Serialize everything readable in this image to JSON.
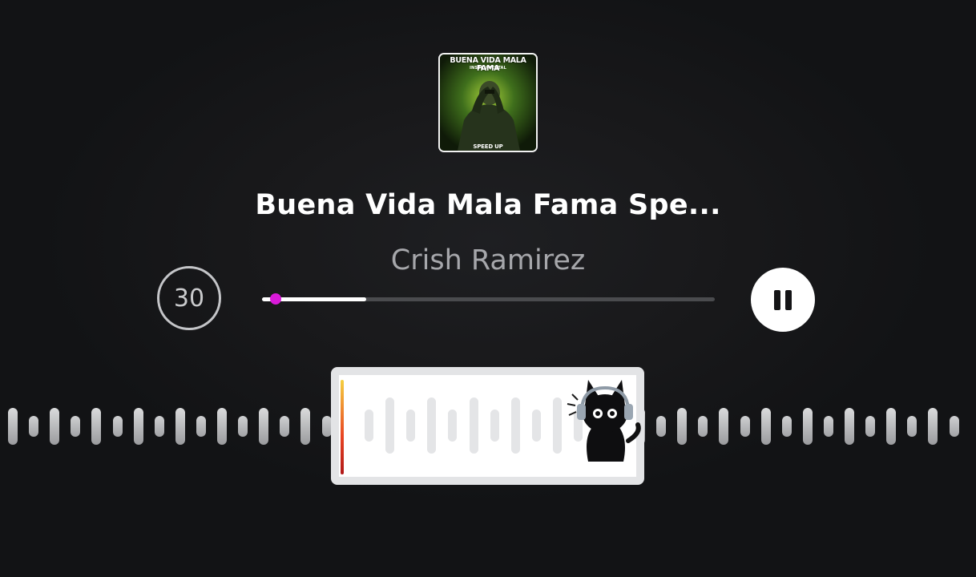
{
  "album": {
    "cover_title": "BUENA VIDA MALA FAMA",
    "cover_subtitle": "INSTRUMENTAL",
    "cover_tag": "SPEED UP"
  },
  "track": {
    "title": "Buena Vida Mala Fama Spe...",
    "artist": "Crish Ramirez"
  },
  "controls": {
    "skip_label": "30",
    "skip_icon": "skip-30-icon",
    "pause_icon": "pause-icon",
    "progress_fraction": 0.23
  },
  "waveform": {
    "selector_icon": "waveform-selector",
    "sticker": "cat-with-headphones-sticker"
  },
  "colors": {
    "background": "#121315",
    "accent": "#d91ad9",
    "text_primary": "#ffffff",
    "text_secondary": "#a6a7ab"
  }
}
